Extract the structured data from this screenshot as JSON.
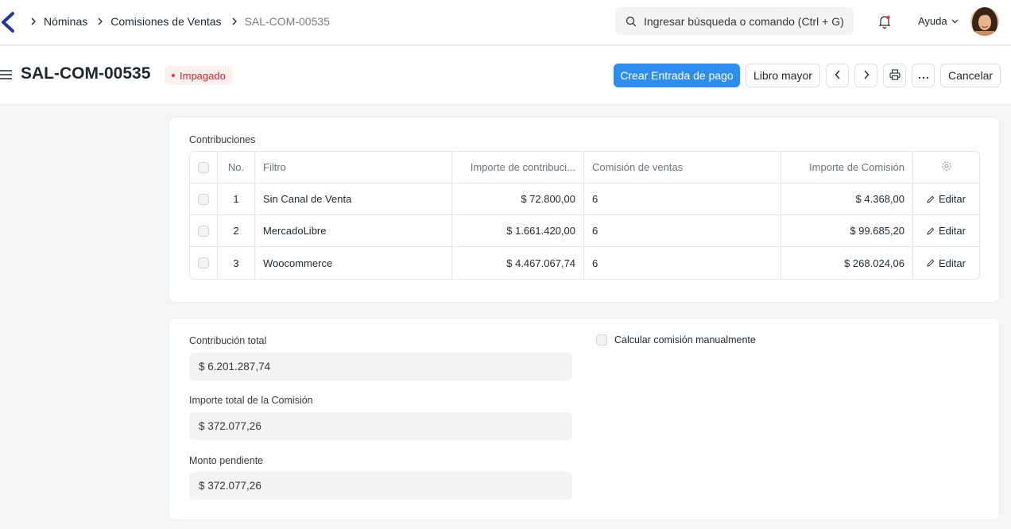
{
  "navbar": {
    "breadcrumbs": [
      "Nóminas",
      "Comisiones de Ventas",
      "SAL-COM-00535"
    ],
    "search_placeholder": "Ingresar búsqueda o comando (Ctrl + G)",
    "help_label": "Ayuda"
  },
  "page": {
    "title": "SAL-COM-00535",
    "status": "Impagado",
    "status_color": "#cc2929",
    "actions": {
      "create_payment": "Crear Entrada de pago",
      "ledger": "Libro mayor",
      "cancel": "Cancelar"
    }
  },
  "contributions": {
    "section_title": "Contribuciones",
    "columns": [
      "No.",
      "Filtro",
      "Importe de contribuci...",
      "Comisión de ventas",
      "Importe de Comisión"
    ],
    "rows": [
      {
        "no": "1",
        "filtro": "Sin Canal de Venta",
        "importe": "$ 72.800,00",
        "comision": "6",
        "importe_comision": "$ 4.368,00",
        "edit": "Editar"
      },
      {
        "no": "2",
        "filtro": "MercadoLibre",
        "importe": "$ 1.661.420,00",
        "comision": "6",
        "importe_comision": "$ 99.685,20",
        "edit": "Editar"
      },
      {
        "no": "3",
        "filtro": "Woocommerce",
        "importe": "$ 4.467.067,74",
        "comision": "6",
        "importe_comision": "$ 268.024,06",
        "edit": "Editar"
      }
    ]
  },
  "totals": {
    "total_contribution_label": "Contribución total",
    "total_contribution_value": "$ 6.201.287,74",
    "total_commission_label": "Importe total de la Comisión",
    "total_commission_value": "$ 372.077,26",
    "pending_label": "Monto pendiente",
    "pending_value": "$ 372.077,26",
    "manual_label": "Calcular comisión manualmente"
  },
  "colors": {
    "primary": "#2e8ef0",
    "badge_bg": "#fff0f0"
  }
}
